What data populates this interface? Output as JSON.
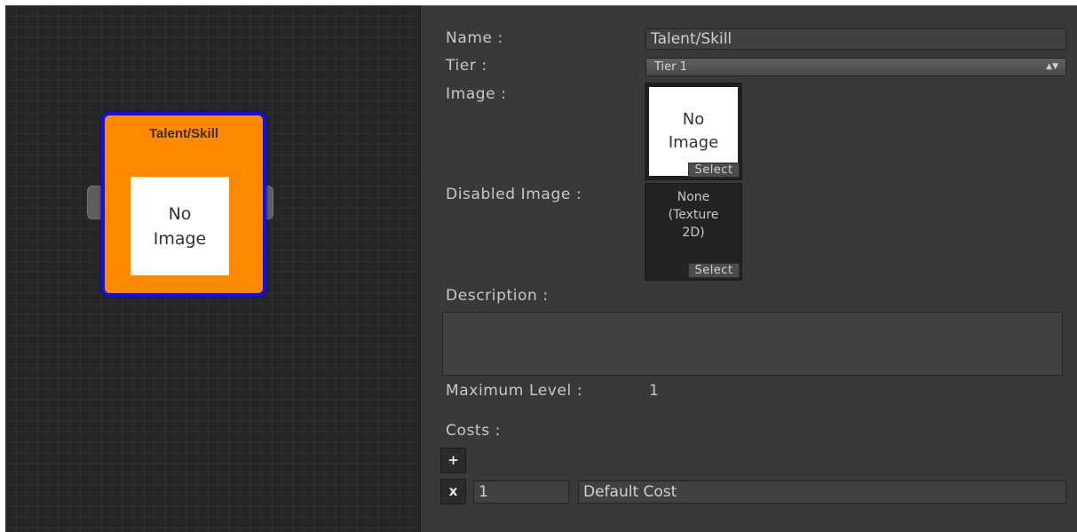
{
  "node": {
    "title": "Talent/Skill",
    "image_placeholder": "No\nImage",
    "fill_color": "#ff8a00",
    "border_color": "#1010e8"
  },
  "inspector": {
    "name_label": "Name :",
    "name_value": "Talent/Skill",
    "tier_label": "Tier :",
    "tier_value": "Tier 1",
    "tier_arrow_icon": "updown-arrow-icon",
    "image_label": "Image :",
    "image_placeholder": "No\nImage",
    "image_select_label": "Select",
    "disabled_image_label": "Disabled Image :",
    "disabled_image_value": "None\n(Texture\n2D)",
    "disabled_image_select_label": "Select",
    "description_label": "Description :",
    "description_value": "",
    "max_level_label": "Maximum Level :",
    "max_level_value": "1",
    "costs_label": "Costs :",
    "add_cost_label": "+",
    "costs": [
      {
        "remove_label": "x",
        "amount": "1",
        "name": "Default Cost"
      }
    ]
  }
}
